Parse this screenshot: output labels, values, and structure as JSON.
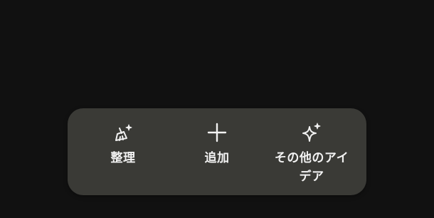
{
  "actions": [
    {
      "label": "整理",
      "icon": "broom-sparkle-icon"
    },
    {
      "label": "追加",
      "icon": "plus-icon"
    },
    {
      "label": "その他のアイデア",
      "icon": "sparkle-icon"
    }
  ],
  "colors": {
    "background": "#111111",
    "bar": "#3a3a36",
    "foreground": "#f2f2f2"
  }
}
